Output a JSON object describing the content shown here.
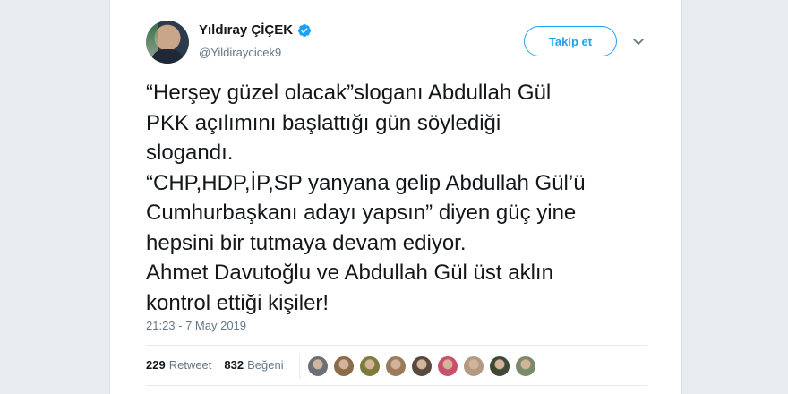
{
  "author": {
    "name": "Yıldıray ÇİÇEK",
    "handle": "@Yildiraycicek9",
    "verified": true
  },
  "follow_button": {
    "label": "Takip et"
  },
  "tweet": {
    "text": "“Herşey güzel olacak”sloganı Abdullah Gül\nPKK açılımını başlattığı gün söylediği\nslogandı.\n“CHP,HDP,İP,SP yanyana gelip Abdullah Gül’ü\nCumhurbaşkanı adayı yapsın” diyen güç yine\nhepsini bir tutmaya devam ediyor.\nAhmet Davutoğlu ve Abdullah Gül üst aklın\nkontrol ettiği kişiler!",
    "timestamp": "21:23 - 7 May 2019"
  },
  "stats": {
    "retweets_count": "229",
    "retweets_label": "Retweet",
    "likes_count": "832",
    "likes_label": "Beğeni"
  },
  "liker_avatars": [
    {
      "color": "#6b6f78"
    },
    {
      "color": "#8a6b4a"
    },
    {
      "color": "#7d7a3c"
    },
    {
      "color": "#9c7b5c"
    },
    {
      "color": "#5a4a3e"
    },
    {
      "color": "#c8506a"
    },
    {
      "color": "#b39a85"
    },
    {
      "color": "#3f4a36"
    },
    {
      "color": "#7a8a6a"
    }
  ],
  "colors": {
    "accent": "#1da1f2",
    "text": "#14171a",
    "muted": "#657786",
    "background": "#e6ecf0"
  }
}
